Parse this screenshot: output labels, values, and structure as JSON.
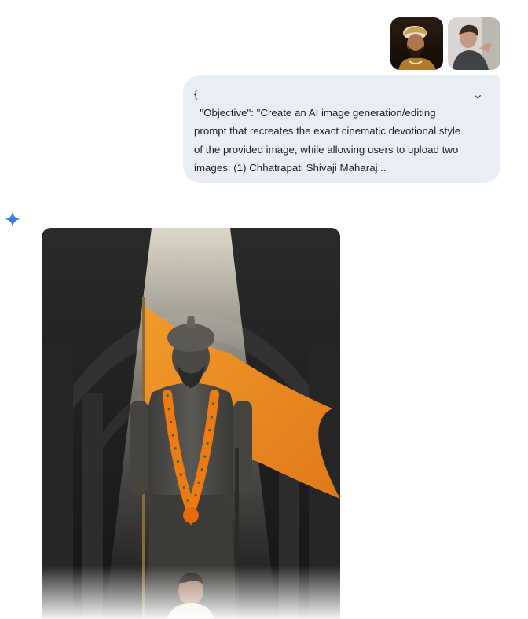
{
  "attachments": [
    {
      "icon": "shivaji-maharaj-portrait-thumbnail"
    },
    {
      "icon": "user-photo-thumbnail"
    }
  ],
  "user_message": {
    "text": "{\n  \"Objective\": \"Create an AI image generation/editing prompt that recreates the exact cinematic devotional style of the provided image, while allowing users to upload two images: (1) Chhatrapati Shivaji Maharaj..."
  },
  "response": {
    "icon": "gemini-sparkle-icon",
    "image": "generated-statue-image"
  },
  "colors": {
    "bubble_bg": "#e9eef6",
    "sparkle_blue": "#4285f4",
    "saffron_flag": "#f08a1c",
    "marigold": "#f07a12"
  }
}
